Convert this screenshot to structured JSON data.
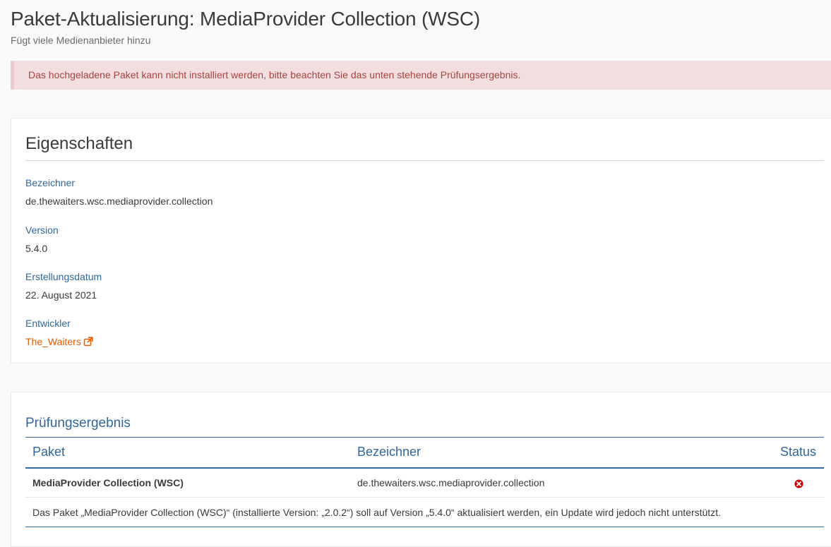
{
  "header": {
    "title": "Paket-Aktualisierung: MediaProvider Collection (WSC)",
    "subtitle": "Fügt viele Medienanbieter hinzu"
  },
  "error": {
    "message": "Das hochgeladene Paket kann nicht installiert werden, bitte beachten Sie das unten stehende Prüfungsergebnis."
  },
  "properties": {
    "title": "Eigenschaften",
    "items": [
      {
        "label": "Bezeichner",
        "value": "de.thewaiters.wsc.mediaprovider.collection"
      },
      {
        "label": "Version",
        "value": "5.4.0"
      },
      {
        "label": "Erstellungsdatum",
        "value": "22. August 2021"
      },
      {
        "label": "Entwickler",
        "value": "The_Waiters"
      }
    ]
  },
  "results": {
    "title": "Prüfungsergebnis",
    "columns": [
      "Paket",
      "Bezeichner",
      "Status"
    ],
    "rows": [
      {
        "package": "MediaProvider Collection (WSC)",
        "identifier": "de.thewaiters.wsc.mediaprovider.collection",
        "status_icon": "error-circle-icon",
        "detail": "Das Paket „MediaProvider Collection (WSC)“ (installierte Version: „2.0.2“) soll auf Version „5.4.0“ aktualisiert werden, ein Update wird jedoch nicht unterstützt."
      }
    ]
  },
  "colors": {
    "accent": "#336699",
    "link": "#e65c00",
    "error_text": "#a94442",
    "error_bg": "#f2dede",
    "status_error": "#cc0000"
  }
}
